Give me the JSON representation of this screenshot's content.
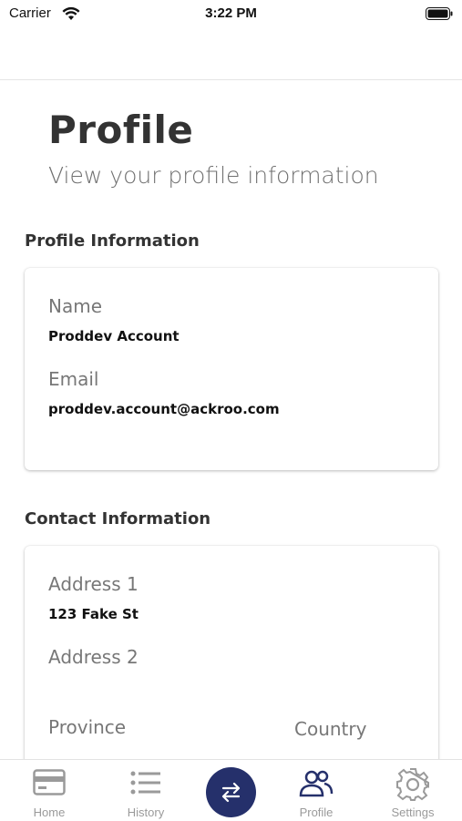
{
  "status_bar": {
    "carrier": "Carrier",
    "time": "3:22 PM"
  },
  "header": {
    "title": "Profile",
    "subtitle": "View your profile information"
  },
  "profile_section": {
    "heading": "Profile Information",
    "name_label": "Name",
    "name_value": "Proddev Account",
    "email_label": "Email",
    "email_value": "proddev.account@ackroo.com"
  },
  "contact_section": {
    "heading": "Contact Information",
    "address1_label": "Address 1",
    "address1_value": "123 Fake St",
    "address2_label": "Address 2",
    "address2_value": "",
    "province_label": "Province",
    "country_label": "Country"
  },
  "tabbar": {
    "tabs": [
      {
        "label": "Home",
        "icon": "card-icon"
      },
      {
        "label": "History",
        "icon": "list-icon"
      },
      {
        "label": "Profile",
        "icon": "users-icon"
      },
      {
        "label": "Settings",
        "icon": "gear-icon"
      }
    ],
    "center_icon": "swap-arrows-icon",
    "active_tab": "Profile"
  },
  "colors": {
    "accent": "#25306b",
    "inactive": "#9a9a9a"
  }
}
